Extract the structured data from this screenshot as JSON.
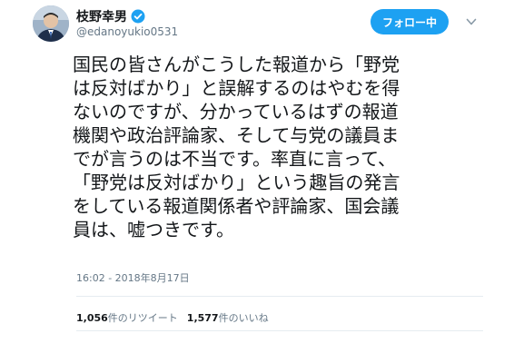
{
  "user": {
    "display_name": "枝野幸男",
    "handle": "@edanoyukio0531",
    "verified": true
  },
  "actions": {
    "follow_label": "フォロー中"
  },
  "tweet": {
    "lines": [
      "国民の皆さんがこうした報道から「野党",
      "は反対ばかり」と誤解するのはやむを得",
      "ないのですが、分かっているはずの報道",
      "機関や政治評論家、そして与党の議員ま",
      "でが言うのは不当です。率直に言って、",
      "「野党は反対ばかり」という趣旨の発言",
      "をしている報道関係者や評論家、国会議",
      "員は、嘘つきです。"
    ],
    "timestamp": "16:02 - 2018年8月17日"
  },
  "stats": {
    "retweets_count": "1,056",
    "retweets_label": "件のリツイート",
    "likes_count": "1,577",
    "likes_label": "件のいいね"
  },
  "colors": {
    "accent": "#1da1f2",
    "verified_badge": "#1da1f2",
    "text_primary": "#14171a",
    "text_secondary": "#657786",
    "divider": "#e6ecf0"
  }
}
